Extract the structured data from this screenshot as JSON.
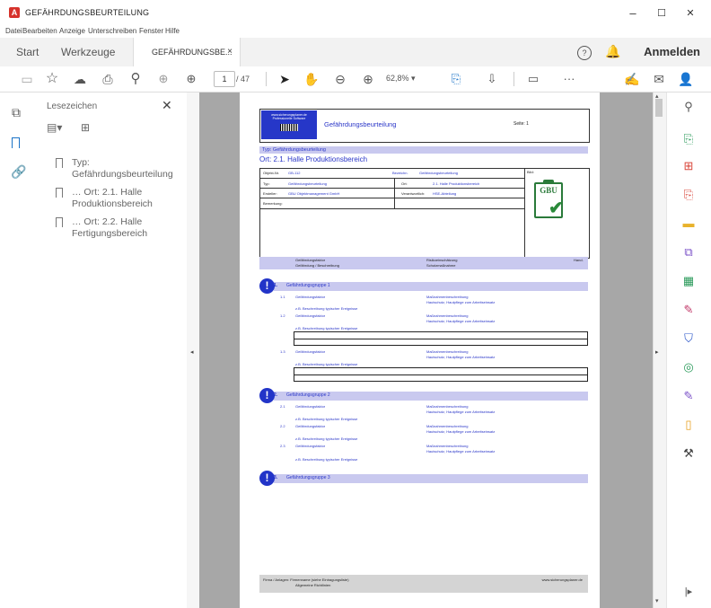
{
  "window": {
    "title": "GEFÄHRDUNGSBEURTEILUNG",
    "minimize": "–",
    "maximize": "☐",
    "close": "✕"
  },
  "menu": [
    "Datei",
    "Bearbeiten",
    "Anzeige",
    "Unterschreiben",
    "Fenster",
    "Hilfe"
  ],
  "tabs": {
    "start": "Start",
    "tools": "Werkzeuge",
    "doc": "GEFÄHRDUNGSBE...",
    "doc_close": "×",
    "signin": "Anmelden"
  },
  "toolbar": {
    "page_current": "1",
    "page_total": "/ 47",
    "zoom": "62,8%",
    "zoom_arrow": "▾"
  },
  "bookmarks": {
    "header": "Lesezeichen",
    "close": "✕",
    "items": [
      {
        "line1": "Typ:",
        "line2": "Gefährdungsbeurteilung"
      },
      {
        "line1": "… Ort: 2.1. Halle",
        "line2": "Produktionsbereich"
      },
      {
        "line1": "… Ort: 2.2. Halle",
        "line2": "Fertigungsbereich"
      }
    ]
  },
  "document": {
    "logo_line1": "www.sicherungsplaner.de",
    "logo_line2": "Professionelle Software",
    "header_title": "Gefährdungsbeurteilung",
    "header_page": "Seite: 1",
    "type_line": "Typ: Gefährdungsbeurteilung",
    "location_line": "Ort: 2.1. Halle Produktionsbereich",
    "info_rows": [
      {
        "label": "Objekt-Nr.",
        "value": "GB-112",
        "label2": "Bezeichn.",
        "value2": "Gefährdungsbeurteilung"
      },
      {
        "label": "Typ:",
        "value": "Gefährdungsbeurteilung",
        "label2": "Ort:",
        "value2": "2.1. Halle Produktionsbereich"
      },
      {
        "label": "Ersteller:",
        "value": "GBU Objektmanagement GmbH",
        "label2": "Verantwortlich:",
        "value2": "HSE-Abteilung"
      },
      {
        "label": "Bemerkung:",
        "value": "",
        "label2": "",
        "value2": ""
      }
    ],
    "bild_label": "Bild:",
    "gbu_badge": "GBU",
    "col_header_left1": "Gefährdungsfaktor",
    "col_header_left2": "Gefährdung / Beschreibung",
    "col_header_mid1": "Risikoeinschätzung",
    "col_header_mid2": "Schutzmaßnahme",
    "col_header_right": "Hand.",
    "groups": [
      {
        "num": "1.",
        "title": "Gefährdungsgruppe 1"
      },
      {
        "num": "2.",
        "title": "Gefährdungsgruppe 2"
      },
      {
        "num": "3.",
        "title": "Gefährdungsgruppe 3"
      }
    ],
    "item_label": "Gefährdungsfaktor",
    "measure_label": "Maßnahmenbeschreibung",
    "measure_sub": "Hautschutz, Hautpflege zum Arbeitseinsatz",
    "desc_label": "z.B. Beschreibung typischer Ereignisse",
    "footer_left": "Firma / Anlagen: Firmenname (siehe Eintragungsliste)",
    "footer_left2": "Allgemeine Richtlinien",
    "footer_right": "www.sicherungsplaner.de"
  }
}
